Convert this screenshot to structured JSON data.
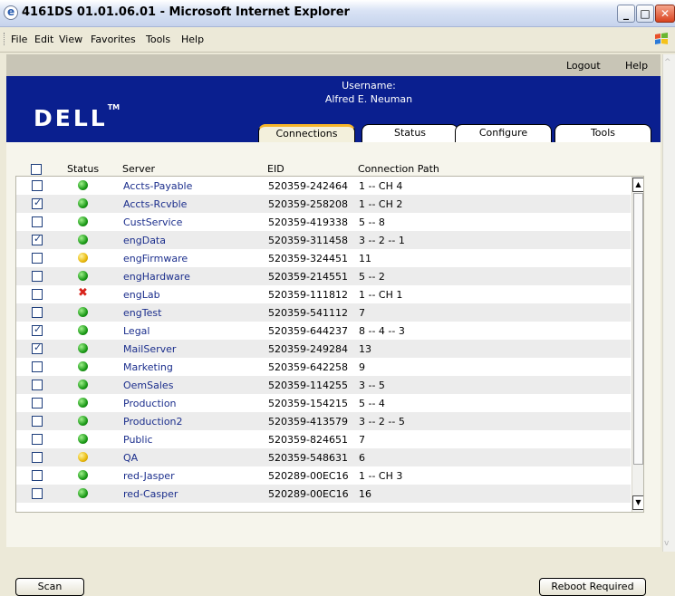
{
  "window": {
    "title": "4161DS 01.01.06.01 - Microsoft Internet Explorer"
  },
  "menu": [
    "File",
    "Edit",
    "View",
    "Favorites",
    "Tools",
    "Help"
  ],
  "topnav": {
    "logout": "Logout",
    "help": "Help"
  },
  "banner": {
    "logo": "DELL",
    "logo_tm": "TM",
    "username_label": "Username:",
    "username": "Alfred E. Neuman"
  },
  "tabs": [
    {
      "label": "Connections",
      "active": true
    },
    {
      "label": "Status",
      "active": false
    },
    {
      "label": "Configure",
      "active": false
    },
    {
      "label": "Tools",
      "active": false
    }
  ],
  "table": {
    "headers": {
      "status": "Status",
      "server": "Server",
      "eid": "EID",
      "path": "Connection Path"
    },
    "rows": [
      {
        "checked": false,
        "status": "green",
        "server": "Accts-Payable",
        "eid": "520359-242464",
        "path": "1 -- CH 4"
      },
      {
        "checked": true,
        "status": "green",
        "server": "Accts-Rcvble",
        "eid": "520359-258208",
        "path": "1 -- CH 2"
      },
      {
        "checked": false,
        "status": "green",
        "server": "CustService",
        "eid": "520359-419338",
        "path": "5 -- 8"
      },
      {
        "checked": true,
        "status": "green",
        "server": "engData",
        "eid": "520359-311458",
        "path": "3 -- 2 -- 1"
      },
      {
        "checked": false,
        "status": "yellow",
        "server": "engFirmware",
        "eid": "520359-324451",
        "path": "11"
      },
      {
        "checked": false,
        "status": "green",
        "server": "engHardware",
        "eid": "520359-214551",
        "path": "5 -- 2"
      },
      {
        "checked": false,
        "status": "error",
        "server": "engLab",
        "eid": "520359-111812",
        "path": "1 -- CH 1"
      },
      {
        "checked": false,
        "status": "green",
        "server": "engTest",
        "eid": "520359-541112",
        "path": "7"
      },
      {
        "checked": true,
        "status": "green",
        "server": "Legal",
        "eid": "520359-644237",
        "path": "8 -- 4 -- 3"
      },
      {
        "checked": true,
        "status": "green",
        "server": "MailServer",
        "eid": "520359-249284",
        "path": "13"
      },
      {
        "checked": false,
        "status": "green",
        "server": "Marketing",
        "eid": "520359-642258",
        "path": "9"
      },
      {
        "checked": false,
        "status": "green",
        "server": "OemSales",
        "eid": "520359-114255",
        "path": "3 -- 5"
      },
      {
        "checked": false,
        "status": "green",
        "server": "Production",
        "eid": "520359-154215",
        "path": "5 -- 4"
      },
      {
        "checked": false,
        "status": "green",
        "server": "Production2",
        "eid": "520359-413579",
        "path": "3 -- 2 -- 5"
      },
      {
        "checked": false,
        "status": "green",
        "server": "Public",
        "eid": "520359-824651",
        "path": "7"
      },
      {
        "checked": false,
        "status": "yellow",
        "server": "QA",
        "eid": "520359-548631",
        "path": "6"
      },
      {
        "checked": false,
        "status": "green",
        "server": "red-Jasper",
        "eid": "520289-00EC16",
        "path": "1 -- CH 3"
      },
      {
        "checked": false,
        "status": "green",
        "server": "red-Casper",
        "eid": "520289-00EC16",
        "path": "16"
      }
    ]
  },
  "buttons": {
    "scan": "Scan",
    "reboot": "Reboot Required"
  },
  "colors": {
    "banner": "#0a1f8f",
    "accent_tab": "#f6b52a",
    "server_link": "#1b2e8c"
  }
}
